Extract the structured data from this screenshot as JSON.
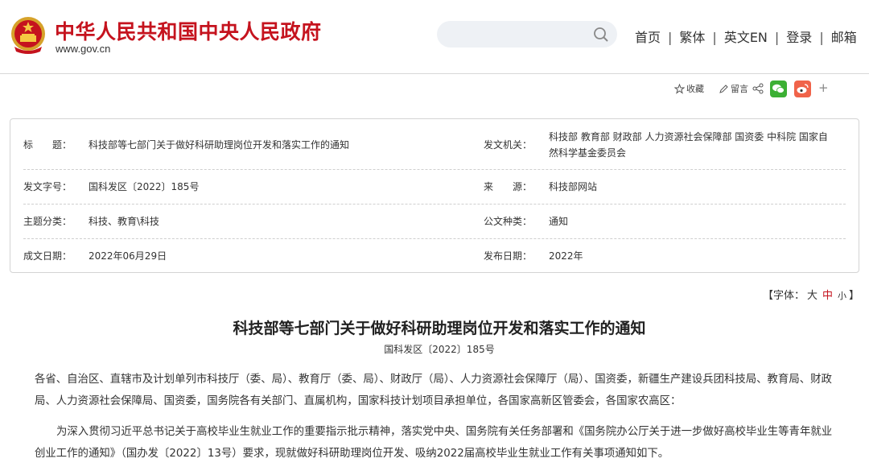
{
  "header": {
    "site_name": "中华人民共和国中央人民政府",
    "site_url": "www.gov.cn",
    "search_placeholder": "",
    "nav": [
      "首页",
      "繁体",
      "英文EN",
      "登录",
      "邮箱"
    ],
    "nav_separator": "|",
    "brand_color": "#c5131e"
  },
  "share": {
    "favorite_label": "收藏",
    "comment_label": "留言",
    "plus_label": "+",
    "icons": [
      "star-icon",
      "pen-icon",
      "share-icon",
      "wechat-icon",
      "weibo-icon"
    ],
    "wechat_color": "#3cb034",
    "weibo_color": "#f0634a"
  },
  "info": {
    "title_label": "标　　题：",
    "title_value": "科技部等七部门关于做好科研助理岗位开发和落实工作的通知",
    "issuer_label": "发文机关：",
    "issuer_value_line1": "科技部  教育部  财政部  人力资源社会保障部  国资委  中科院  国家自",
    "issuer_value_line2": "然科学基金委员会",
    "docno_label": "发文字号：",
    "docno_value": "国科发区〔2022〕185号",
    "source_label": "来　　源：",
    "source_value": "科技部网站",
    "topic_label": "主题分类：",
    "topic_value": "科技、教育\\科技",
    "doctype_label": "公文种类：",
    "doctype_value": "通知",
    "created_label": "成文日期：",
    "created_value": "2022年06月29日",
    "published_label": "发布日期：",
    "published_value": "2022年"
  },
  "font_size": {
    "prefix": "【字体：",
    "large": "大",
    "medium": "中",
    "small": "小",
    "suffix": "】"
  },
  "article": {
    "title": "科技部等七部门关于做好科研助理岗位开发和落实工作的通知",
    "doc_number": "国科发区〔2022〕185号",
    "para1": "各省、自治区、直辖市及计划单列市科技厅（委、局）、教育厅（委、局）、财政厅（局）、人力资源社会保障厅（局）、国资委，新疆生产建设兵团科技局、教育局、财政局、人力资源社会保障局、国资委，国务院各有关部门、直属机构，国家科技计划项目承担单位，各国家高新区管委会，各国家农高区：",
    "para2": "为深入贯彻习近平总书记关于高校毕业生就业工作的重要指示批示精神，落实党中央、国务院有关任务部署和《国务院办公厅关于进一步做好高校毕业生等青年就业创业工作的通知》（国办发〔2022〕13号）要求，现就做好科研助理岗位开发、吸纳2022届高校毕业生就业工作有关事项通知如下。"
  }
}
